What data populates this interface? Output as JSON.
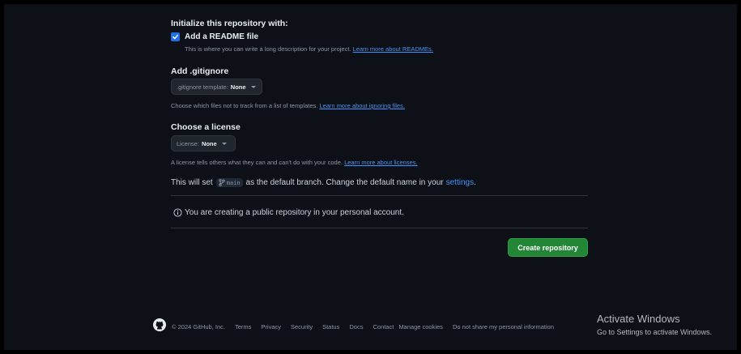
{
  "init": {
    "heading": "Initialize this repository with:",
    "readme_label": "Add a README file",
    "readme_desc": "This is where you can write a long description for your project.",
    "readme_link": "Learn more about READMEs."
  },
  "gitignore": {
    "heading": "Add .gitignore",
    "dropdown_prefix": ".gitignore template:",
    "dropdown_value": "None",
    "desc": "Choose which files not to track from a list of templates.",
    "link": "Learn more about ignoring files."
  },
  "license": {
    "heading": "Choose a license",
    "dropdown_prefix": "License:",
    "dropdown_value": "None",
    "desc": "A license tells others what they can and can't do with your code.",
    "link": "Learn more about licenses."
  },
  "branch": {
    "prefix": "This will set",
    "name": "main",
    "suffix": "as the default branch. Change the default name in your",
    "settings_link": "settings",
    "period": "."
  },
  "notice": "You are creating a public repository in your personal account.",
  "create_button": "Create repository",
  "footer": {
    "copyright": "© 2024 GitHub, Inc.",
    "links": [
      "Terms",
      "Privacy",
      "Security",
      "Status",
      "Docs",
      "Contact",
      "Manage cookies",
      "Do not share my personal information"
    ]
  },
  "watermark": {
    "title": "Activate Windows",
    "subtitle": "Go to Settings to activate Windows."
  },
  "colors": {
    "bg": "#0d1117",
    "accent": "#238636",
    "link": "#4493f8",
    "checkbox": "#1f6feb"
  }
}
